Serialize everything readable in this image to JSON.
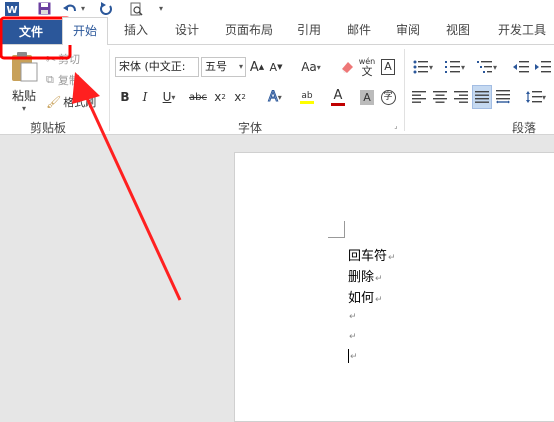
{
  "qat": {
    "word_icon": "W",
    "save_icon": "save-icon",
    "undo_icon": "undo-icon",
    "redo_icon": "redo-icon",
    "preview_icon": "print-preview-icon",
    "customize_icon": "customize-icon"
  },
  "tabs": {
    "file": "文件",
    "home": "开始",
    "insert": "插入",
    "design": "设计",
    "layout": "页面布局",
    "references": "引用",
    "mailings": "邮件",
    "review": "审阅",
    "view": "视图",
    "developer": "开发工具"
  },
  "clipboard": {
    "paste": "粘贴",
    "cut": "剪切",
    "copy": "复制",
    "format_painter": "格式刷",
    "group_label": "剪贴板"
  },
  "font": {
    "font_name": "宋体 (中文正:",
    "font_size": "五号",
    "grow": "A",
    "shrink": "A",
    "case": "Aa",
    "bold": "B",
    "italic": "I",
    "underline": "U",
    "strike": "abc",
    "subscript": "x",
    "superscript": "x",
    "phonetic": "wén",
    "phonetic_sub": "文",
    "border_char": "A",
    "text_effect": "A",
    "highlight": "ab",
    "font_color": "A",
    "char_shading": "A",
    "enclose": "字",
    "group_label": "字体"
  },
  "paragraph": {
    "group_label": "段落"
  },
  "document": {
    "lines": [
      "回车符",
      "删除",
      "如何",
      "",
      "",
      ""
    ],
    "pilcrow": "↵"
  },
  "colors": {
    "accent": "#2b579a",
    "highlight_red": "#ff0000"
  }
}
